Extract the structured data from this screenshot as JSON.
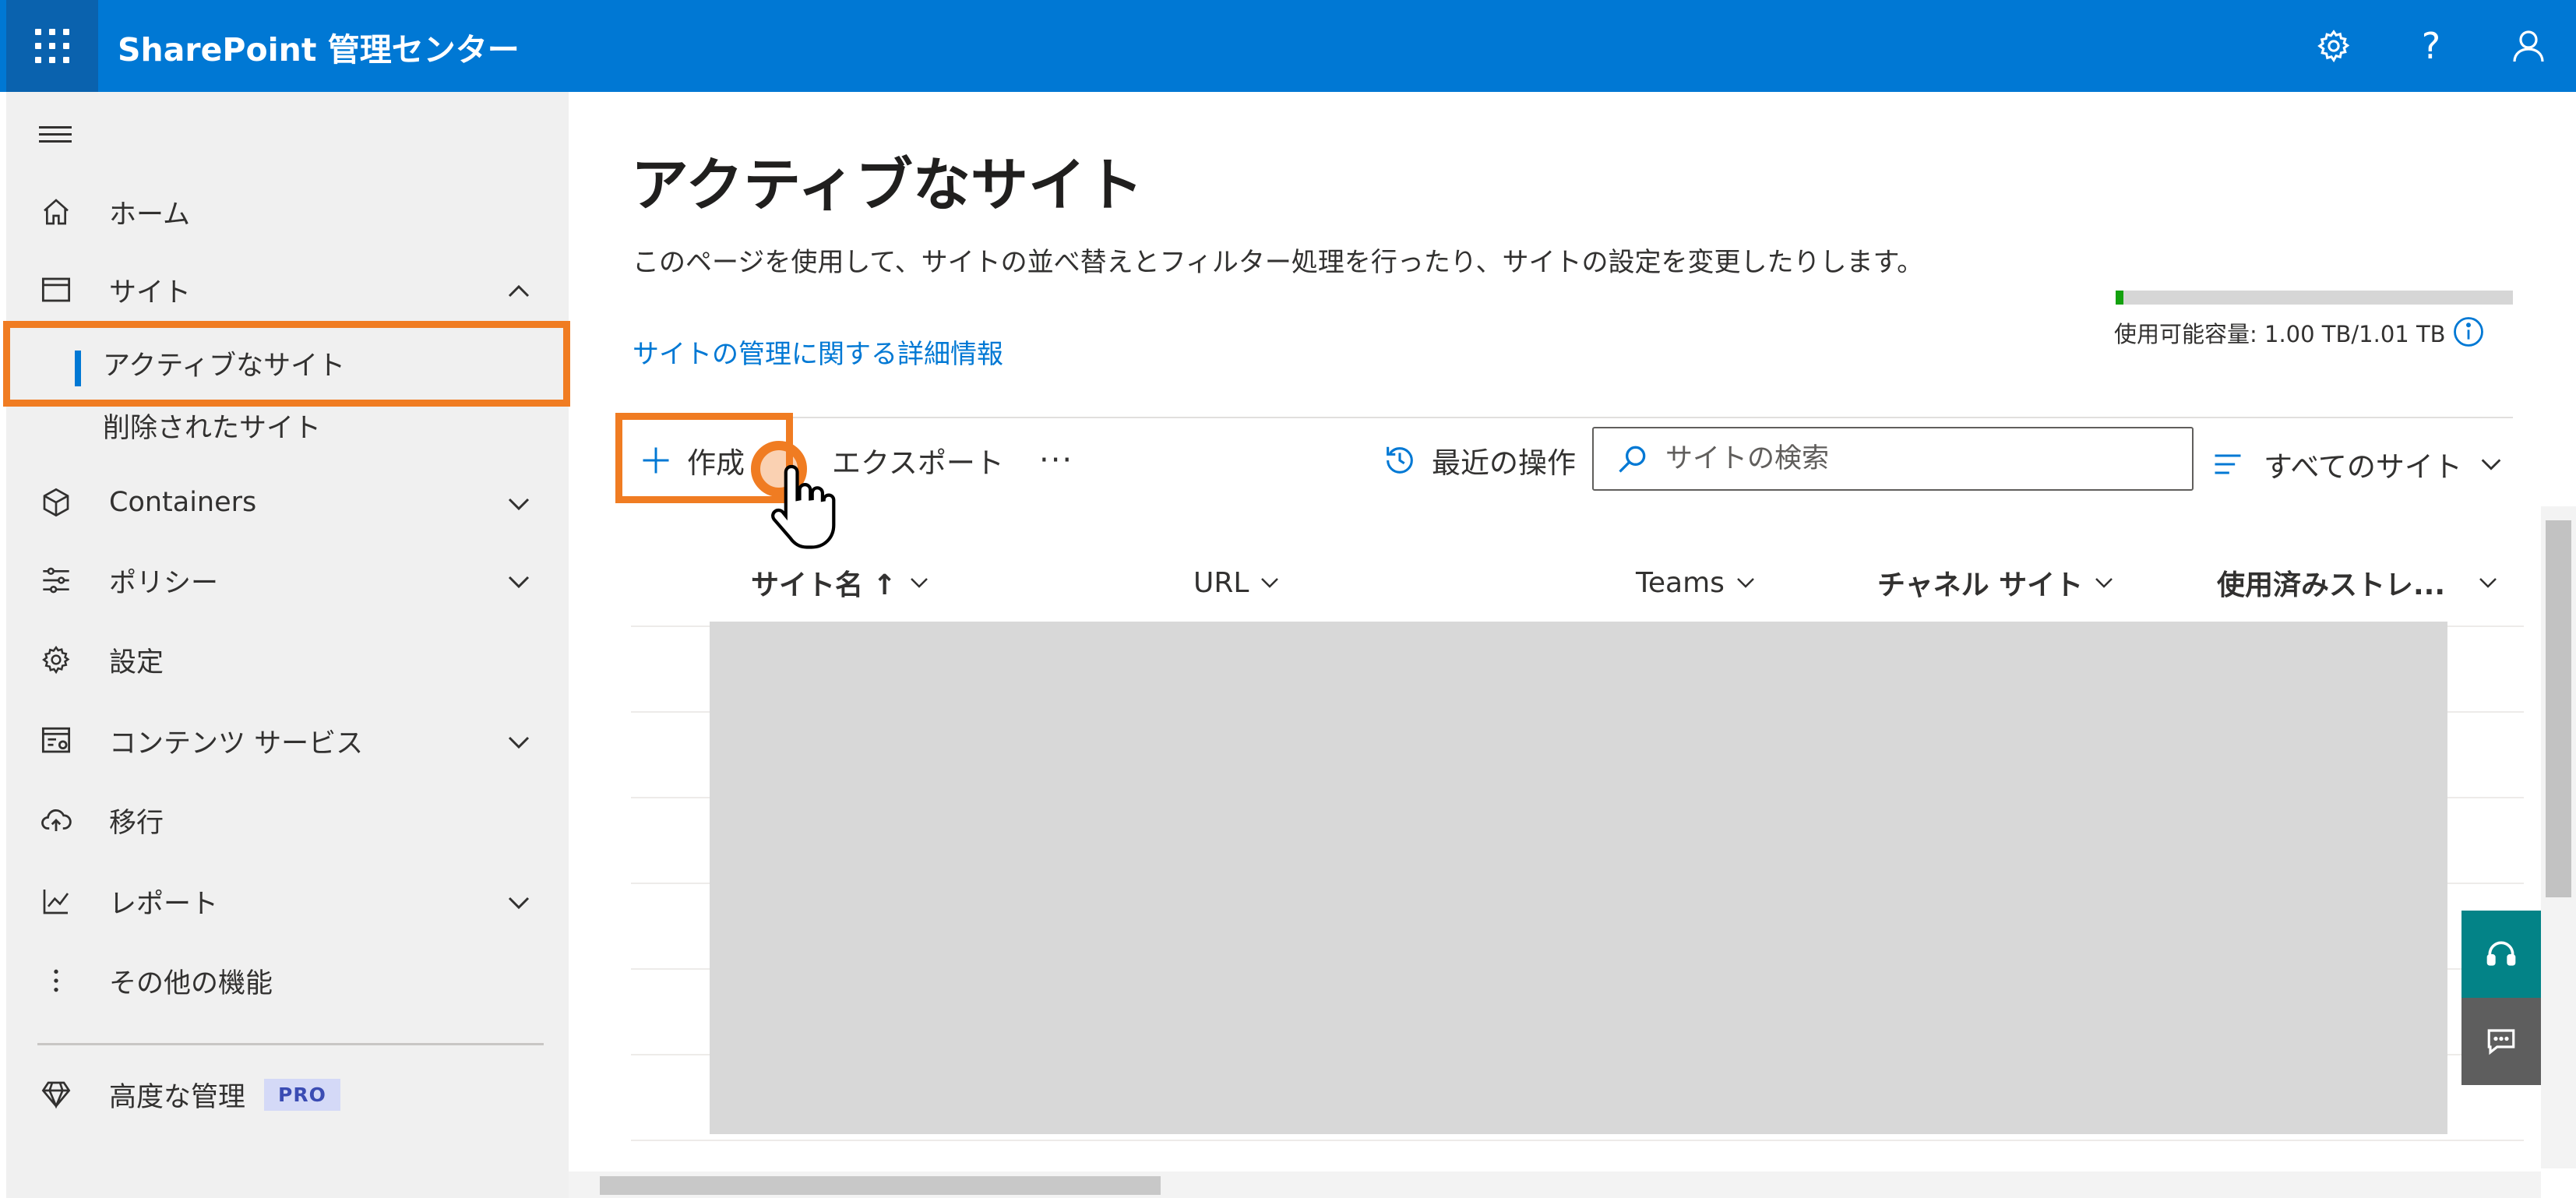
{
  "header": {
    "app_title": "SharePoint 管理センター",
    "icons": [
      "waffle-icon",
      "gear-icon",
      "help-icon",
      "user-icon"
    ],
    "help_glyph": "?",
    "brand_color": "#0078d4"
  },
  "sidebar": {
    "items": [
      {
        "label": "ホーム",
        "icon": "home-icon"
      },
      {
        "label": "サイト",
        "icon": "site-icon",
        "expanded": true
      },
      {
        "label": "Containers",
        "icon": "cube-icon"
      },
      {
        "label": "ポリシー",
        "icon": "sliders-icon"
      },
      {
        "label": "設定",
        "icon": "gear-icon"
      },
      {
        "label": "コンテンツ サービス",
        "icon": "content-services-icon"
      },
      {
        "label": "移行",
        "icon": "cloud-upload-icon"
      },
      {
        "label": "レポート",
        "icon": "chart-icon"
      },
      {
        "label": "その他の機能",
        "icon": "more-vertical-icon"
      },
      {
        "label": "高度な管理",
        "icon": "diamond-icon",
        "badge": "PRO"
      }
    ],
    "sub_items": [
      {
        "label": "アクティブなサイト",
        "active": true
      },
      {
        "label": "削除されたサイト"
      }
    ],
    "highlight_color": "#f07c22"
  },
  "main": {
    "title": "アクティブなサイト",
    "description": "このページを使用して、サイトの並べ替えとフィルター処理を行ったり、サイトの設定を変更したりします。",
    "link": "サイトの管理に関する詳細情報",
    "storage": {
      "text": "使用可能容量: 1.00 TB/1.01 TB",
      "used_fraction": 0.02,
      "color": "#13a10e"
    },
    "toolbar": {
      "create": "作成",
      "export": "エクスポート",
      "more": "···",
      "recent": "最近の操作",
      "search_placeholder": "サイトの検索",
      "filter": "すべてのサイト"
    },
    "table": {
      "columns": [
        "サイト名 ↑",
        "URL",
        "Teams",
        "チャネル サイト",
        "使用済みストレ..."
      ]
    }
  }
}
